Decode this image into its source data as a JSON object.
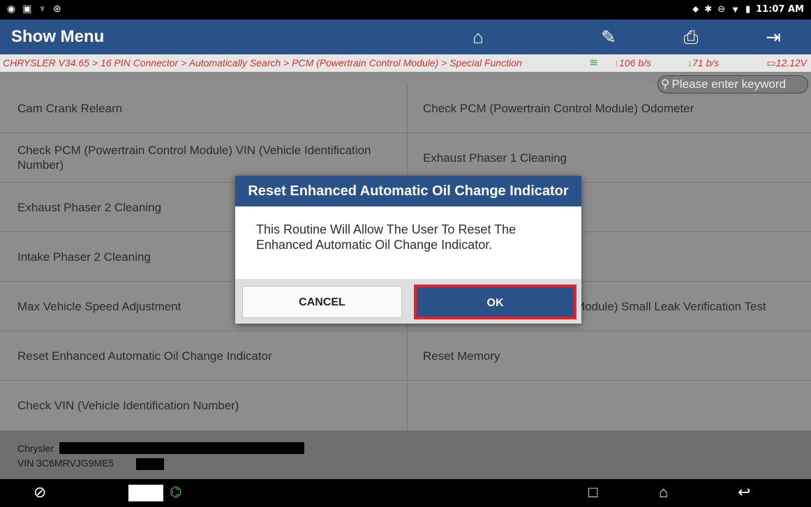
{
  "statusbar": {
    "left_icons": [
      "chrome-icon",
      "image-icon",
      "usb-icon",
      "sync-icon"
    ],
    "right_icons": [
      "location-icon",
      "bluetooth-icon",
      "dnd-icon",
      "wifi-icon",
      "battery-icon"
    ],
    "time": "11:07 AM"
  },
  "header": {
    "title": "Show Menu",
    "buttons": [
      "home-icon",
      "edit-report-icon",
      "print-icon",
      "exit-icon"
    ]
  },
  "breadcrumb": {
    "path": "CHRYSLER V34.65 > 16 PIN Connector > Automatically Search > PCM (Powertrain Control Module) > Special Function",
    "upload": "106 b/s",
    "download": "71 b/s",
    "voltage": "12.12V"
  },
  "search": {
    "placeholder": "Please enter keyword"
  },
  "functions": {
    "left": [
      "Cam Crank Relearn",
      "Check PCM (Powertrain Control Module) VIN (Vehicle Identification Number)",
      "Exhaust Phaser 2 Cleaning",
      "Intake Phaser 2 Cleaning",
      "Max Vehicle Speed Adjustment",
      "Reset Enhanced Automatic Oil Change Indicator",
      "Check VIN (Vehicle Identification Number)"
    ],
    "right": [
      "Check PCM (Powertrain Control Module) Odometer",
      "Exhaust Phaser 1 Cleaning",
      "",
      "",
      "Module) Small Leak Verification Test",
      "Reset Memory",
      ""
    ]
  },
  "footer": {
    "make": "Chrysler",
    "vin": "VIN 3C6MRVJG9ME5"
  },
  "dialog": {
    "title": "Reset Enhanced Automatic Oil Change Indicator",
    "message": "This Routine Will Allow The User To Reset The Enhanced Automatic Oil Change Indicator.",
    "cancel_label": "CANCEL",
    "ok_label": "OK"
  },
  "colors": {
    "header": "#2a5288",
    "highlight": "#e2212b",
    "breadcrumb_text": "#d8342b"
  }
}
